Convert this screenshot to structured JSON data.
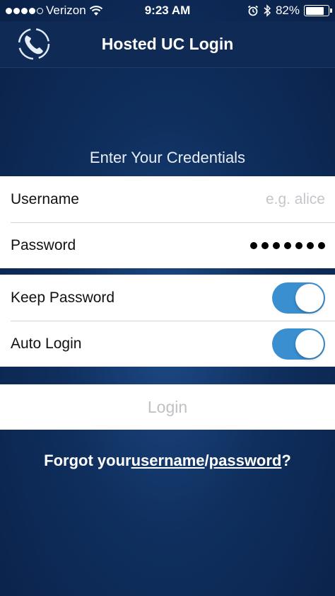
{
  "status_bar": {
    "carrier": "Verizon",
    "time": "9:23 AM",
    "battery": "82%",
    "battery_level": 0.82,
    "icons": [
      "signal-dots",
      "wifi-icon",
      "alarm-icon",
      "bluetooth-icon",
      "battery-icon"
    ]
  },
  "nav": {
    "title": "Hosted UC Login",
    "icon": "phone-icon"
  },
  "form": {
    "section_title": "Enter Your Credentials",
    "username_label": "Username",
    "username_placeholder": "e.g. alice",
    "username_value": "",
    "password_label": "Password",
    "password_mask_length": 7,
    "keep_password_label": "Keep Password",
    "keep_password_on": true,
    "auto_login_label": "Auto Login",
    "auto_login_on": true
  },
  "login_button": "Login",
  "forgot": {
    "prefix": "Forgot your",
    "username_link": "username",
    "separator": "/",
    "password_link": "password",
    "suffix": "?"
  },
  "colors": {
    "background": "#0f2f5e",
    "toggle_on": "#3a8fd1",
    "placeholder": "#c5c6cb"
  }
}
